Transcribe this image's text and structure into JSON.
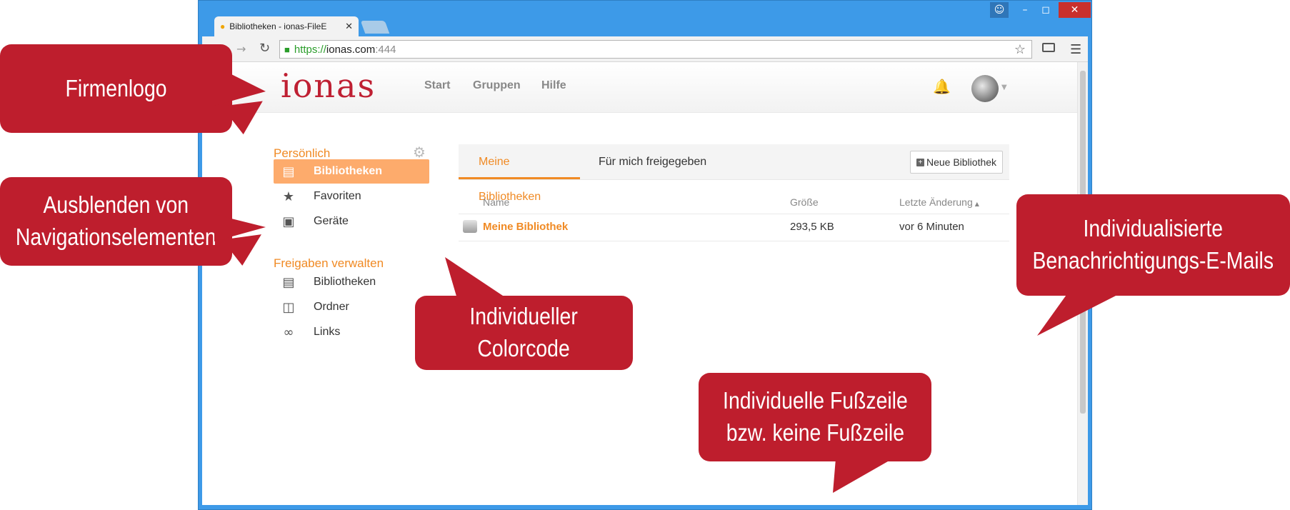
{
  "browser": {
    "tab_title": "Bibliotheken - ionas-FileE",
    "url_scheme": "https://",
    "url_host": "ionas.com",
    "url_port": ":444"
  },
  "header": {
    "logo_text": "ionas",
    "nav": [
      "Start",
      "Gruppen",
      "Hilfe"
    ]
  },
  "sidebar": {
    "personal_heading": "Persönlich",
    "personal_items": [
      {
        "label": "Bibliotheken",
        "icon": "library-icon",
        "active": true
      },
      {
        "label": "Favoriten",
        "icon": "star-icon",
        "active": false
      },
      {
        "label": "Geräte",
        "icon": "monitor-icon",
        "active": false
      }
    ],
    "shares_heading": "Freigaben verwalten",
    "share_items": [
      {
        "label": "Bibliotheken",
        "icon": "library-icon"
      },
      {
        "label": "Ordner",
        "icon": "folder-icon"
      },
      {
        "label": "Links",
        "icon": "link-icon"
      }
    ]
  },
  "main": {
    "tabs": [
      "Meine Bibliotheken",
      "Für mich freigegeben"
    ],
    "active_tab": 0,
    "new_button": "Neue Bibliothek",
    "columns": [
      "Name",
      "Größe",
      "Letzte Änderung"
    ],
    "rows": [
      {
        "name": "Meine Bibliothek",
        "size": "293,5 KB",
        "changed": "vor 6 Minuten"
      }
    ]
  },
  "callouts": {
    "logo": [
      "Firmenlogo"
    ],
    "nav": [
      "Ausblenden von",
      "Navigationselementen"
    ],
    "color": [
      "Individueller",
      "Colorcode"
    ],
    "mail": [
      "Individualisierte",
      "Benachrichtigungs-E-Mails"
    ],
    "footer": [
      "Individuelle Fußzeile",
      "bzw. keine Fußzeile"
    ]
  },
  "colors": {
    "accent": "#f08a24",
    "active_item": "#fdab6c",
    "brand": "#bf2033",
    "callout": "#be1e2d",
    "window": "#3d9ae8"
  }
}
